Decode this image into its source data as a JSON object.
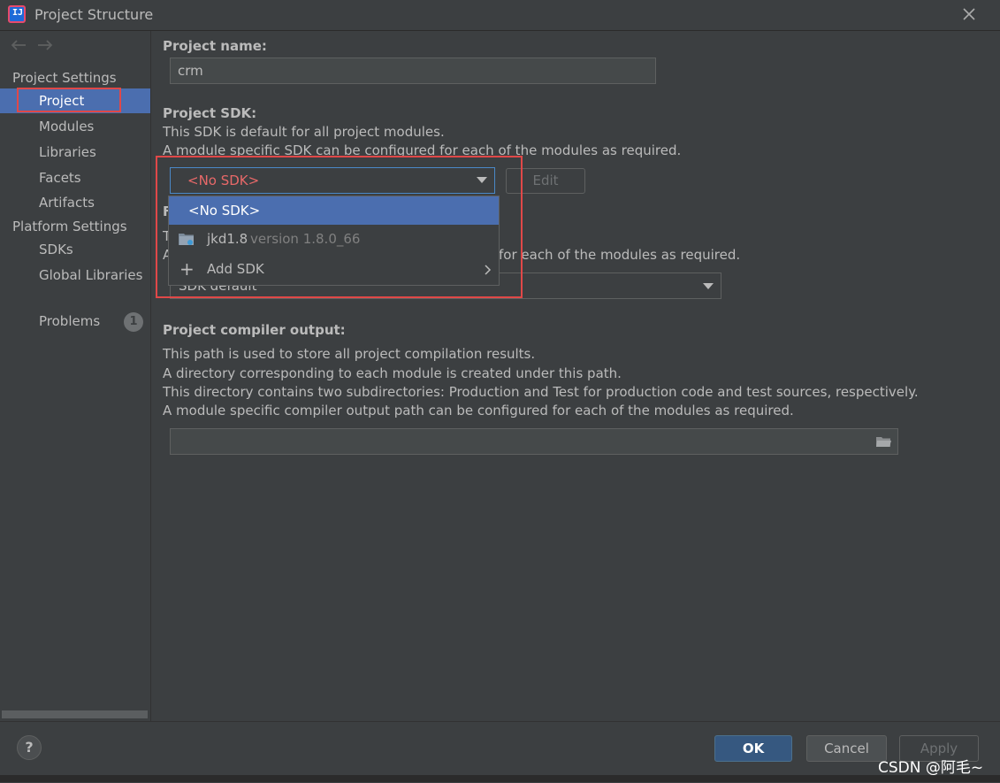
{
  "window": {
    "title": "Project Structure",
    "app_icon_text": "IJ"
  },
  "sidebar": {
    "project_settings_header": "Project Settings",
    "project_settings_items": [
      "Project",
      "Modules",
      "Libraries",
      "Facets",
      "Artifacts"
    ],
    "platform_settings_header": "Platform Settings",
    "platform_settings_items": [
      "SDKs",
      "Global Libraries"
    ],
    "problems_label": "Problems",
    "problems_count": "1",
    "selected_item": "Project"
  },
  "main": {
    "project_name_label": "Project name:",
    "project_name_value": "crm",
    "sdk_label": "Project SDK:",
    "sdk_desc_1": "This SDK is default for all project modules.",
    "sdk_desc_2": "A module specific SDK can be configured for each of the modules as required.",
    "sdk_selected": "<No SDK>",
    "edit_label": "Edit",
    "lang_label_partial": "F",
    "lang_desc_partial_1": "T",
    "lang_desc_partial_2": "A",
    "lang_desc_tail": "for each of the modules as required.",
    "lang_select_value": "SDK default",
    "output_label": "Project compiler output:",
    "output_desc_1": "This path is used to store all project compilation results.",
    "output_desc_2": "A directory corresponding to each module is created under this path.",
    "output_desc_3": "This directory contains two subdirectories: Production and Test for production code and test sources, respectively.",
    "output_desc_4": "A module specific compiler output path can be configured for each of the modules as required.",
    "output_path_value": ""
  },
  "sdk_popup": {
    "items": [
      {
        "label": "<No SDK>",
        "selected": true
      },
      {
        "label": "jkd1.8",
        "detail": "version 1.8.0_66"
      },
      {
        "label": "Add SDK",
        "has_submenu": true
      }
    ]
  },
  "footer": {
    "help_label": "?",
    "ok_label": "OK",
    "cancel_label": "Cancel",
    "apply_label": "Apply",
    "watermark": "CSDN @阿毛~"
  },
  "colors": {
    "background": "#3c3f41",
    "selection": "#4b6eaf",
    "error_text": "#e86969",
    "highlight_box": "#e04848",
    "ok_button": "#365880"
  }
}
